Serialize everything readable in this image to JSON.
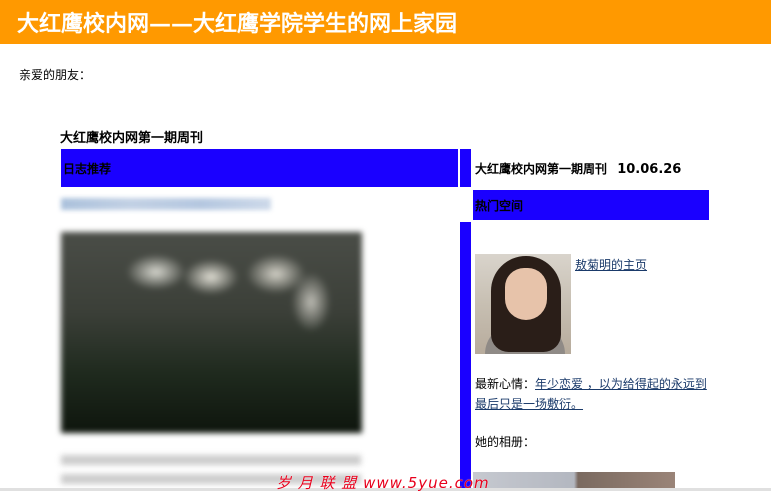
{
  "header": {
    "title": "大红鹰校内网——大红鹰学院学生的网上家园"
  },
  "greeting": "亲爱的朋友：",
  "issue_title": "大红鹰校内网第一期周刊",
  "left_section": {
    "header": "日志推荐"
  },
  "right_section": {
    "title": "大红鹰校内网第一期周刊",
    "date": "10.06.26",
    "header": "热门空间",
    "homepage_link": "敖菊明的主页",
    "mood_label": "最新心情：",
    "mood_text": "年少恋爱 ，以为给得起的永远到最后只是一场敷衍。",
    "album_label": "她的相册："
  },
  "watermark": "岁 月 联 盟  www.5yue.com",
  "colors": {
    "header_bg": "#ff9900",
    "accent_blue": "#1a00ff",
    "link": "#1a3a6a"
  }
}
